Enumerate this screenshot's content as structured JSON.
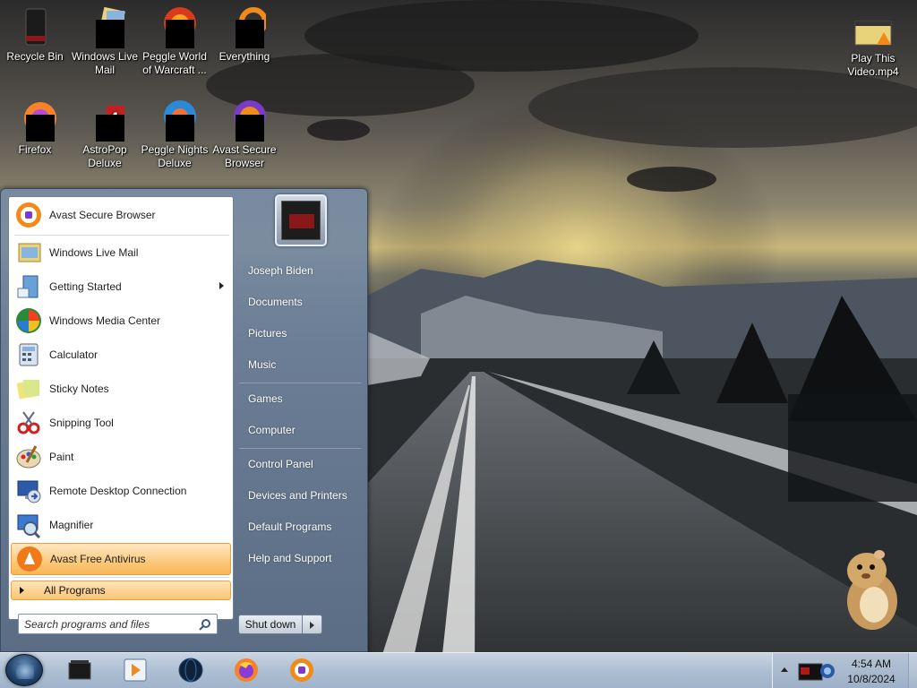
{
  "desktop": {
    "icons": [
      {
        "label": "Recycle Bin"
      },
      {
        "label": "Windows Live Mail"
      },
      {
        "label": "Peggle World of Warcraft ..."
      },
      {
        "label": "Everything"
      },
      {
        "label": "Firefox"
      },
      {
        "label": "AstroPop Deluxe"
      },
      {
        "label": "Peggle Nights Deluxe"
      },
      {
        "label": "Avast Secure Browser"
      },
      {
        "label": "Play This Video.mp4"
      }
    ]
  },
  "start_menu": {
    "pinned": [
      {
        "label": "Avast Secure Browser",
        "icon": "avast-browser-icon"
      }
    ],
    "recent": [
      {
        "label": "Windows Live Mail",
        "icon": "mail-icon"
      },
      {
        "label": "Getting Started",
        "icon": "getting-started-icon",
        "has_submenu": true
      },
      {
        "label": "Windows Media Center",
        "icon": "media-center-icon"
      },
      {
        "label": "Calculator",
        "icon": "calculator-icon"
      },
      {
        "label": "Sticky Notes",
        "icon": "sticky-notes-icon"
      },
      {
        "label": "Snipping Tool",
        "icon": "scissors-icon"
      },
      {
        "label": "Paint",
        "icon": "paint-palette-icon"
      },
      {
        "label": "Remote Desktop Connection",
        "icon": "remote-desktop-icon"
      },
      {
        "label": "Magnifier",
        "icon": "magnifier-icon"
      },
      {
        "label": "Avast Free Antivirus",
        "icon": "avast-antivirus-icon",
        "highlighted": true
      }
    ],
    "all_programs": "All Programs",
    "search_placeholder": "Search programs and files",
    "right": {
      "group1": [
        "Joseph Biden",
        "Documents",
        "Pictures",
        "Music"
      ],
      "group2": [
        "Games",
        "Computer"
      ],
      "group3": [
        "Control Panel",
        "Devices and Printers",
        "Default Programs",
        "Help and Support"
      ]
    },
    "shutdown": "Shut down"
  },
  "taskbar": {
    "buttons": [
      {
        "name": "taskbar-app-1",
        "icon": "dark-box-icon"
      },
      {
        "name": "taskbar-media-player",
        "icon": "media-player-icon"
      },
      {
        "name": "taskbar-app-3",
        "icon": "globe-icon"
      },
      {
        "name": "taskbar-firefox",
        "icon": "firefox-icon"
      },
      {
        "name": "taskbar-avast-browser",
        "icon": "avast-browser-icon"
      }
    ],
    "clock": {
      "time": "4:54 AM",
      "date": "10/8/2024"
    }
  },
  "colors": {
    "menu_highlight": "#fbc97a",
    "taskbar": "#aebfd3",
    "menu_text": "#1e1e1e",
    "right_text": "#ffffff"
  }
}
